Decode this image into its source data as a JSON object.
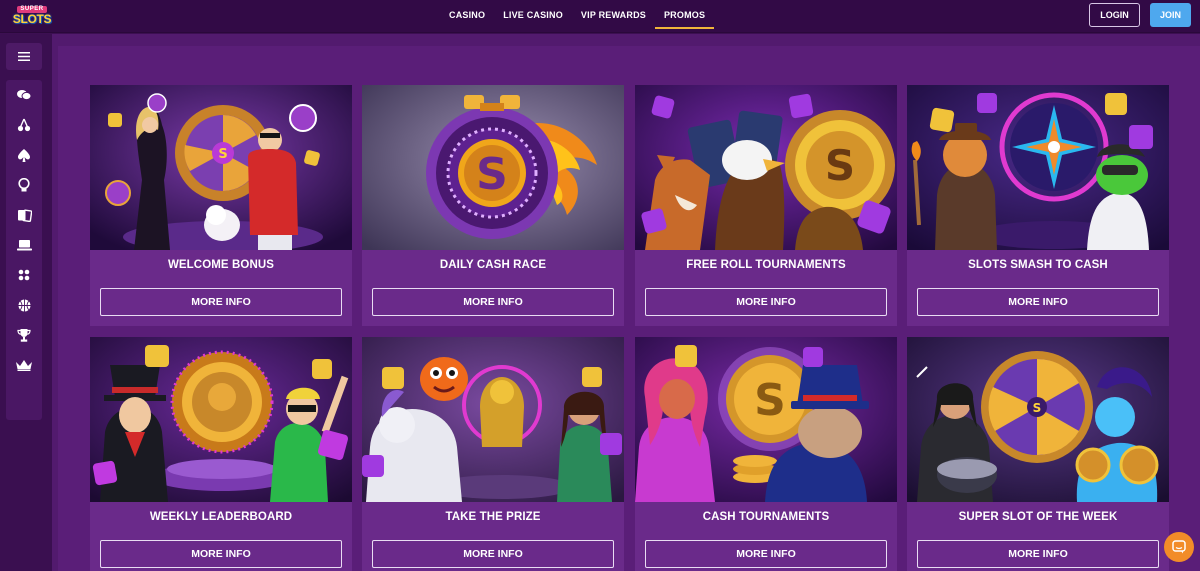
{
  "brand": {
    "logo_top": "SUPER",
    "logo_bottom": "SLOTS"
  },
  "nav": [
    {
      "label": "CASINO",
      "active": false
    },
    {
      "label": "LIVE CASINO",
      "active": false
    },
    {
      "label": "VIP REWARDS",
      "active": false
    },
    {
      "label": "PROMOS",
      "active": true
    }
  ],
  "auth": {
    "login_label": "LOGIN",
    "join_label": "JOIN"
  },
  "sidebar": {
    "items": [
      {
        "icon": "chat-bubbles-icon"
      },
      {
        "icon": "cherries-icon"
      },
      {
        "icon": "spade-icon"
      },
      {
        "icon": "ball-machine-icon"
      },
      {
        "icon": "cards-icon"
      },
      {
        "icon": "laptop-icon"
      },
      {
        "icon": "dots-grid-icon"
      },
      {
        "icon": "basketball-icon"
      },
      {
        "icon": "trophy-icon"
      },
      {
        "icon": "crown-icon"
      }
    ]
  },
  "promos": [
    {
      "title": "WELCOME BONUS",
      "button": "MORE INFO",
      "image": "wheel-couple-art"
    },
    {
      "title": "DAILY CASH RACE",
      "button": "MORE INFO",
      "image": "stopwatch-coin-art"
    },
    {
      "title": "FREE ROLL TOURNAMENTS",
      "button": "MORE INFO",
      "image": "animals-cards-art"
    },
    {
      "title": "SLOTS SMASH TO CASH",
      "button": "MORE INFO",
      "image": "cat-frog-star-art"
    },
    {
      "title": "WEEKLY LEADERBOARD",
      "button": "MORE INFO",
      "image": "magician-medallion-art"
    },
    {
      "title": "TAKE THE PRIZE",
      "button": "MORE INFO",
      "image": "monsters-idol-art"
    },
    {
      "title": "CASH TOURNAMENTS",
      "button": "MORE INFO",
      "image": "fox-bulldog-coins-art"
    },
    {
      "title": "SUPER SLOT OF THE WEEK",
      "button": "MORE INFO",
      "image": "drummer-genie-wheel-art"
    }
  ],
  "colors": {
    "page_bg": "#3c0f52",
    "content_bg": "#5a1e78",
    "card_bg": "#6a2a8a",
    "accent_gold": "#f0b43a",
    "join_blue": "#4ea8ee",
    "chat_orange": "#f28c28"
  }
}
